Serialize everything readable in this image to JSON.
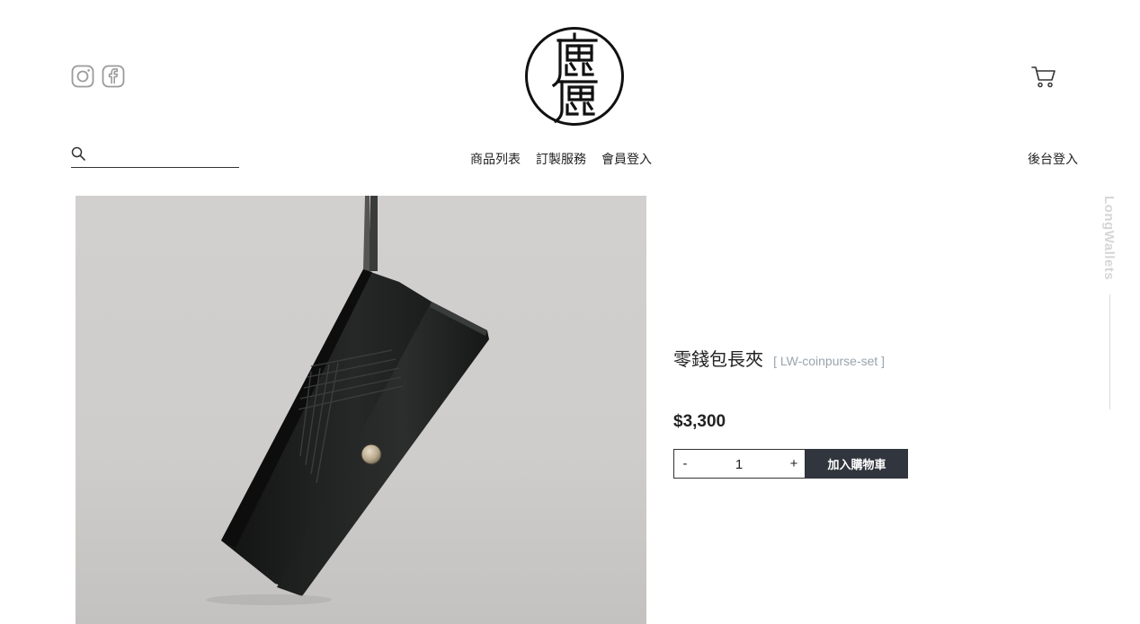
{
  "header": {
    "social": [
      {
        "name": "instagram-icon",
        "color": "#9b9b9b"
      },
      {
        "name": "facebook-icon",
        "color": "#9b9b9b"
      }
    ],
    "logo": {
      "glyph_top": "鹿",
      "glyph_bottom": "鹿"
    },
    "cart_icon": "cart-icon"
  },
  "search": {
    "value": "",
    "icon": "search-icon"
  },
  "nav": {
    "items": [
      "商品列表",
      "訂製服務",
      "會員登入"
    ],
    "admin_label": "後台登入"
  },
  "sidebar_label": "LongWallets",
  "product": {
    "name": "零錢包長夾",
    "sku": "[ LW-coinpurse-set ]",
    "price": "$3,300",
    "quantity": "1",
    "minus_label": "-",
    "plus_label": "+",
    "add_to_cart_label": "加入購物車"
  },
  "colors": {
    "button_bg": "#31353d",
    "muted_text": "#9aa4ad",
    "sidebar_label": "#d6d6d6"
  }
}
